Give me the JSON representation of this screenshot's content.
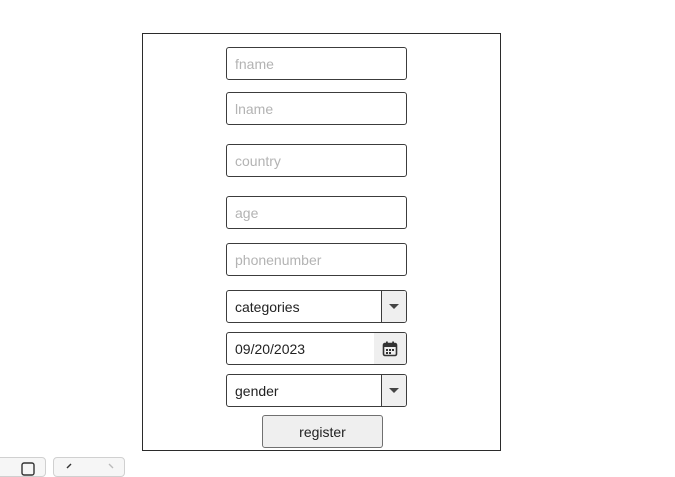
{
  "form": {
    "fname_placeholder": "fname",
    "lname_placeholder": "lname",
    "country_placeholder": "country",
    "age_placeholder": "age",
    "phonenumber_placeholder": "phonenumber",
    "categories_selected": "categories",
    "date_value": "09/20/2023",
    "gender_selected": "gender",
    "register_label": "register"
  },
  "icons": {
    "date_picker": "calendar-icon",
    "select_arrow": "chevron-down-icon"
  },
  "colors": {
    "border": "#3c3c3c",
    "placeholder": "#b3b3b3",
    "button_bg": "#efefef"
  }
}
